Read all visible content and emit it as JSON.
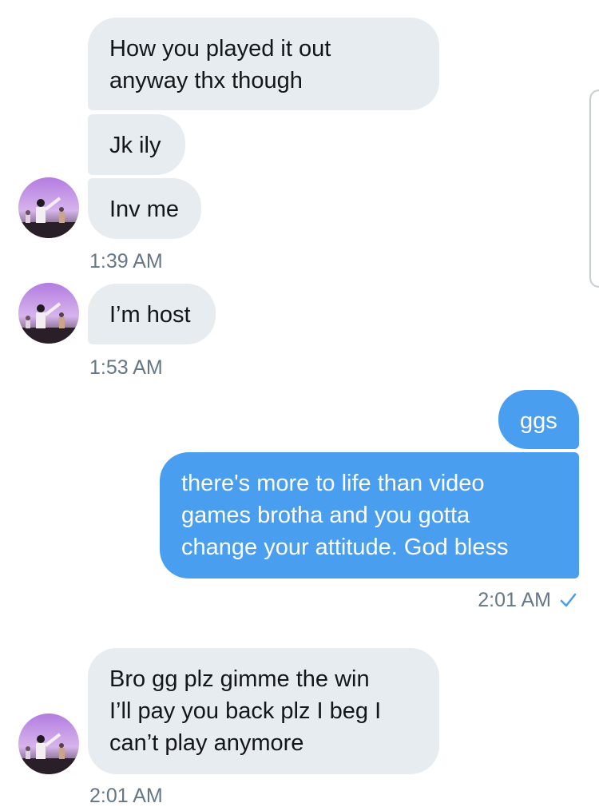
{
  "conversation": {
    "incoming_1": {
      "messages": [
        {
          "lines": [
            "How you played it out",
            "anyway thx though"
          ]
        },
        {
          "lines": [
            "Jk ily"
          ]
        },
        {
          "lines": [
            "Inv me"
          ]
        }
      ],
      "time": "1:39 AM"
    },
    "incoming_2": {
      "messages": [
        {
          "lines": [
            "I’m host"
          ]
        }
      ],
      "time": "1:53 AM"
    },
    "outgoing": {
      "messages": [
        {
          "lines": [
            "ggs"
          ]
        },
        {
          "lines": [
            "there's more to life than video",
            "games brotha and you gotta",
            "change your attitude. God bless"
          ]
        }
      ],
      "time": "2:01 AM",
      "status_icon": "check-icon"
    },
    "incoming_3": {
      "messages": [
        {
          "lines": [
            "Bro gg plz gimme the win",
            "I’ll pay you back plz I beg I",
            "can’t play anymore"
          ]
        }
      ],
      "time": "2:01 AM"
    }
  },
  "colors": {
    "incoming_bubble": "#e6ecf0",
    "outgoing_bubble": "#4a9ef0",
    "timestamp": "#657786",
    "check": "#4a9ef0"
  }
}
